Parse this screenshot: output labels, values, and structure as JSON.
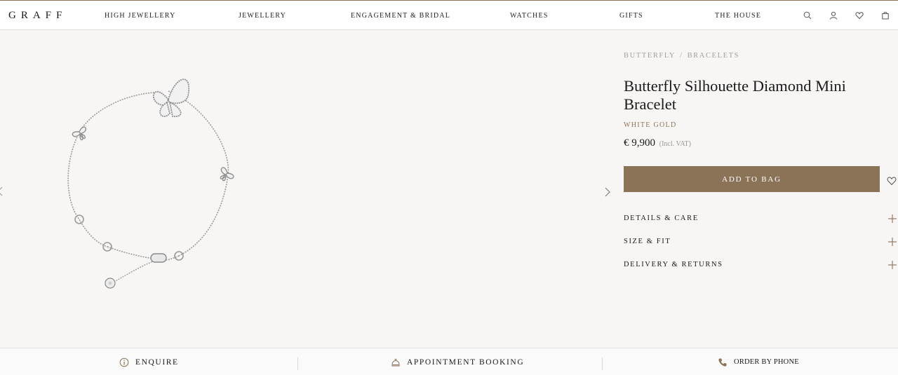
{
  "header": {
    "logo": "GRAFF",
    "nav": [
      "HIGH JEWELLERY",
      "JEWELLERY",
      "ENGAGEMENT & BRIDAL",
      "WATCHES",
      "GIFTS",
      "THE HOUSE"
    ],
    "icons": [
      "search-icon",
      "account-icon",
      "wishlist-icon",
      "bag-icon"
    ]
  },
  "breadcrumb": {
    "items": [
      "BUTTERFLY",
      "BRACELETS"
    ],
    "separator": "/"
  },
  "product": {
    "title": "Butterfly Silhouette Diamond Mini Bracelet",
    "metal": "WHITE GOLD",
    "price": "€ 9,900",
    "vat": "(Incl. VAT)",
    "image_alt": "butterfly-bracelet-image"
  },
  "actions": {
    "add_to_bag": "ADD TO BAG"
  },
  "accordion": [
    "DETAILS & CARE",
    "SIZE & FIT",
    "DELIVERY & RETURNS"
  ],
  "footer": {
    "enquire": "ENQUIRE",
    "appointment": "APPOINTMENT BOOKING",
    "phone": "ORDER BY PHONE"
  },
  "colors": {
    "accent": "#8b7358",
    "background": "#f8f6f5",
    "header_bg": "#ffffff",
    "text": "#1a1a1a",
    "muted": "#a39e9a"
  }
}
